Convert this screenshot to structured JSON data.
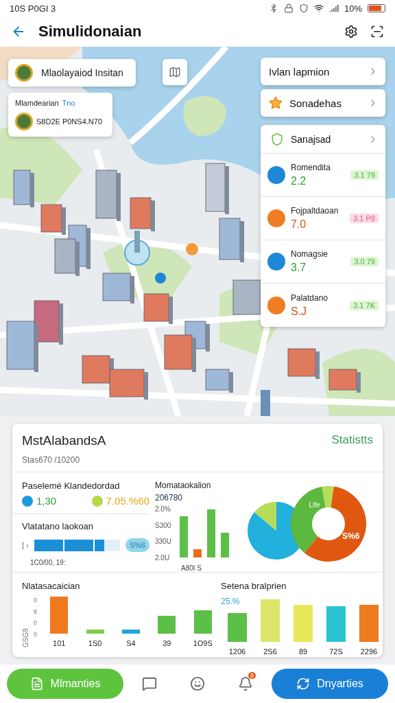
{
  "status_bar": {
    "time": "10S P0GI 3",
    "battery": "10%"
  },
  "header": {
    "title": "Simulidonaian"
  },
  "map": {
    "search_card": {
      "label": "Mlaolayaiod Insitan"
    },
    "info_card": {
      "title": "Mlamdearian",
      "tag": "Tno",
      "value": "S8D2E P0NS4.N70"
    },
    "menu": [
      {
        "label": "Ivlan lapmion",
        "kind": "plain"
      },
      {
        "label": "Sonadehas",
        "kind": "star"
      }
    ],
    "list": {
      "title": "Sanajsad",
      "items": [
        {
          "name": "Romendita",
          "value": {
            "text": "2.2",
            "color": "#2e9e3a"
          },
          "badge": "3.1 79",
          "color": "#1e88d6",
          "positive": true
        },
        {
          "name": "Fojpaltdaoan",
          "value": {
            "text": "7.0",
            "color": "#d2541c"
          },
          "badge": "3.1 P8",
          "color": "#ef7d22",
          "positive": false
        },
        {
          "name": "Nomagsie",
          "value": {
            "text": "3.7",
            "color": "#2e9e3a"
          },
          "badge": "3.0 79",
          "color": "#1e88d6",
          "positive": true
        },
        {
          "name": "Palatdano",
          "value": {
            "text": "S.J",
            "color": "#d2541c"
          },
          "badge": "3.1 7K",
          "color": "#ef7d22",
          "positive": true
        }
      ]
    }
  },
  "stats": {
    "title": "MstAlabandsA",
    "subtitle": "Stas670 /10200",
    "link": "Statistts",
    "summary": {
      "title": "Paselemé Klandedordad",
      "items": [
        {
          "value": {
            "text": "1,30",
            "color": "#2e9e3a"
          },
          "color": "#1e9be0"
        },
        {
          "value": {
            "text": "7.05.%60",
            "color": "#e3a81a"
          },
          "color": "#b8d84a"
        }
      ]
    },
    "progress": {
      "title": "Vlatatano laokoan",
      "prefix": "[ ›",
      "pill": "S%6",
      "caption": "1C0/00, 19:",
      "level": 0.82
    },
    "mini_bars": {
      "title": "Momataokalion",
      "total": "206780",
      "ticks": [
        "2.0%",
        "S300",
        "330U",
        "2.0U"
      ],
      "caption": "A80I S"
    },
    "pie": {
      "inner_label": "Life",
      "outer_label": "S%6"
    },
    "left_bars": {
      "title": "Nlatasacaician",
      "axis_title": "GSG9",
      "ticks": [
        "0",
        "8",
        "0",
        "0"
      ],
      "labels": [
        "101",
        "1S0",
        "S4",
        "39",
        "1O9S"
      ]
    },
    "right_bars": {
      "title": "Setena bralprien",
      "note": "25.%",
      "labels": [
        "1206",
        "2S6",
        "89",
        "72S",
        "2296"
      ]
    }
  },
  "nav": [
    {
      "kind": "pill",
      "label": "Mlmanties",
      "color": "#5ec43e"
    },
    {
      "kind": "chat"
    },
    {
      "kind": "face"
    },
    {
      "kind": "bell",
      "badge": "9"
    },
    {
      "kind": "pill",
      "label": "Dnyarties",
      "color": "#1a7fd6"
    }
  ]
}
